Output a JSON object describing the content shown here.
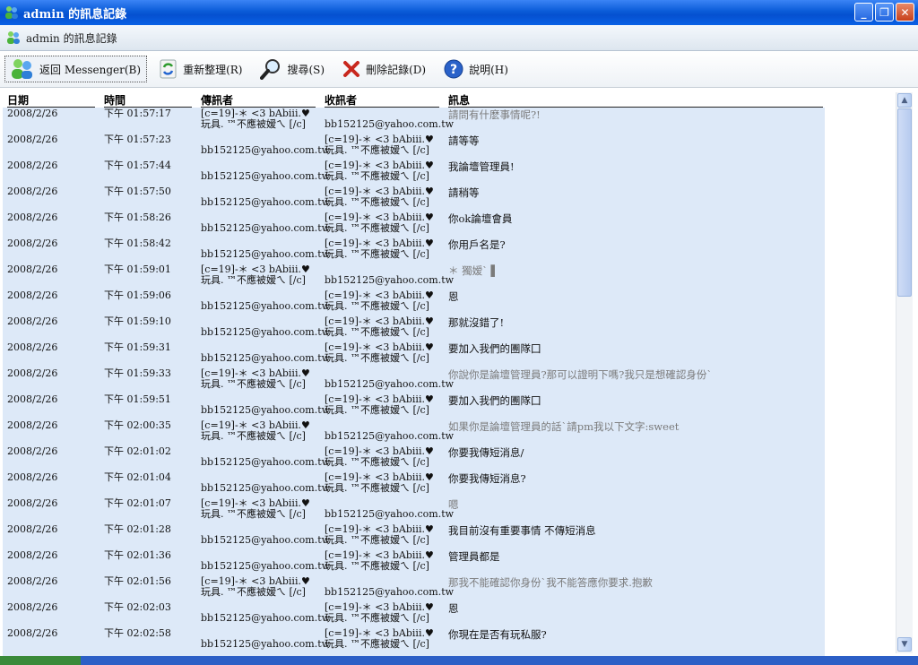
{
  "window": {
    "title": "admin 的訊息記錄"
  },
  "header": {
    "title": "admin 的訊息記錄"
  },
  "toolbar": {
    "back": "返回 Messenger(B)",
    "refresh": "重新整理(R)",
    "search": "搜尋(S)",
    "delete": "刪除記錄(D)",
    "help": "說明(H)"
  },
  "columns": {
    "date": "日期",
    "time": "時間",
    "from": "傳訊者",
    "to": "收訊者",
    "message": "訊息"
  },
  "rows": [
    {
      "date": "2008/2/26",
      "time": "下午 01:57:17",
      "from": "[c=19]-＊ <3 bAbiii.♥玩具. ™不應被嫒ㄟ [/c]",
      "to": "bb152125@yahoo.com.tw",
      "msg": "請問有什麽事情呢?!",
      "grey": true
    },
    {
      "date": "2008/2/26",
      "time": "下午 01:57:23",
      "from": "bb152125@yahoo.com.tw",
      "to": "[c=19]-＊ <3 bAbiii.♥玩具. ™不應被嫒ㄟ [/c]",
      "msg": "請等等",
      "grey": false
    },
    {
      "date": "2008/2/26",
      "time": "下午 01:57:44",
      "from": "bb152125@yahoo.com.tw",
      "to": "[c=19]-＊ <3 bAbiii.♥玩具. ™不應被嫒ㄟ [/c]",
      "msg": "我論壇管理員!",
      "grey": false
    },
    {
      "date": "2008/2/26",
      "time": "下午 01:57:50",
      "from": "bb152125@yahoo.com.tw",
      "to": "[c=19]-＊ <3 bAbiii.♥玩具. ™不應被嫒ㄟ [/c]",
      "msg": "請稍等",
      "grey": false
    },
    {
      "date": "2008/2/26",
      "time": "下午 01:58:26",
      "from": "bb152125@yahoo.com.tw",
      "to": "[c=19]-＊ <3 bAbiii.♥玩具. ™不應被嫒ㄟ [/c]",
      "msg": "你ok論壇會員",
      "grey": false
    },
    {
      "date": "2008/2/26",
      "time": "下午 01:58:42",
      "from": "bb152125@yahoo.com.tw",
      "to": "[c=19]-＊ <3 bAbiii.♥玩具. ™不應被嫒ㄟ [/c]",
      "msg": "你用戶名是?",
      "grey": false
    },
    {
      "date": "2008/2/26",
      "time": "下午 01:59:01",
      "from": "[c=19]-＊ <3 bAbiii.♥玩具. ™不應被嫒ㄟ [/c]",
      "to": "bb152125@yahoo.com.tw",
      "msg": "＊ 獨嫒` ▌",
      "grey": true
    },
    {
      "date": "2008/2/26",
      "time": "下午 01:59:06",
      "from": "bb152125@yahoo.com.tw",
      "to": "[c=19]-＊ <3 bAbiii.♥玩具. ™不應被嫒ㄟ [/c]",
      "msg": "恩",
      "grey": false
    },
    {
      "date": "2008/2/26",
      "time": "下午 01:59:10",
      "from": "bb152125@yahoo.com.tw",
      "to": "[c=19]-＊ <3 bAbiii.♥玩具. ™不應被嫒ㄟ [/c]",
      "msg": "那就沒錯了!",
      "grey": false
    },
    {
      "date": "2008/2/26",
      "time": "下午 01:59:31",
      "from": "bb152125@yahoo.com.tw",
      "to": "[c=19]-＊ <3 bAbiii.♥玩具. ™不應被嫒ㄟ [/c]",
      "msg": "要加入我們的團隊囗",
      "grey": false
    },
    {
      "date": "2008/2/26",
      "time": "下午 01:59:33",
      "from": "[c=19]-＊ <3 bAbiii.♥玩具. ™不應被嫒ㄟ [/c]",
      "to": "bb152125@yahoo.com.tw",
      "msg": "你說你是論壇管理員?那可以證明下嗎?我只是想確認身份`",
      "grey": true
    },
    {
      "date": "2008/2/26",
      "time": "下午 01:59:51",
      "from": "bb152125@yahoo.com.tw",
      "to": "[c=19]-＊ <3 bAbiii.♥玩具. ™不應被嫒ㄟ [/c]",
      "msg": "要加入我們的團隊囗",
      "grey": false
    },
    {
      "date": "2008/2/26",
      "time": "下午 02:00:35",
      "from": "[c=19]-＊ <3 bAbiii.♥玩具. ™不應被嫒ㄟ [/c]",
      "to": "bb152125@yahoo.com.tw",
      "msg": "如果你是論壇管理員的話`請pm我以下文字:sweet",
      "grey": true
    },
    {
      "date": "2008/2/26",
      "time": "下午 02:01:02",
      "from": "bb152125@yahoo.com.tw",
      "to": "[c=19]-＊ <3 bAbiii.♥玩具. ™不應被嫒ㄟ [/c]",
      "msg": "你要我傳短消息/",
      "grey": false
    },
    {
      "date": "2008/2/26",
      "time": "下午 02:01:04",
      "from": "bb152125@yahoo.com.tw",
      "to": "[c=19]-＊ <3 bAbiii.♥玩具. ™不應被嫒ㄟ [/c]",
      "msg": "你要我傳短消息?",
      "grey": false
    },
    {
      "date": "2008/2/26",
      "time": "下午 02:01:07",
      "from": "[c=19]-＊ <3 bAbiii.♥玩具. ™不應被嫒ㄟ [/c]",
      "to": "bb152125@yahoo.com.tw",
      "msg": "嗯",
      "grey": true
    },
    {
      "date": "2008/2/26",
      "time": "下午 02:01:28",
      "from": "bb152125@yahoo.com.tw",
      "to": "[c=19]-＊ <3 bAbiii.♥玩具. ™不應被嫒ㄟ [/c]",
      "msg": "我目前沒有重要事情 不傳短消息",
      "grey": false
    },
    {
      "date": "2008/2/26",
      "time": "下午 02:01:36",
      "from": "bb152125@yahoo.com.tw",
      "to": "[c=19]-＊ <3 bAbiii.♥玩具. ™不應被嫒ㄟ [/c]",
      "msg": "管理員都是",
      "grey": false
    },
    {
      "date": "2008/2/26",
      "time": "下午 02:01:56",
      "from": "[c=19]-＊ <3 bAbiii.♥玩具. ™不應被嫒ㄟ [/c]",
      "to": "bb152125@yahoo.com.tw",
      "msg": "那我不能確認你身份`我不能答應你要求.抱歉",
      "grey": true
    },
    {
      "date": "2008/2/26",
      "time": "下午 02:02:03",
      "from": "bb152125@yahoo.com.tw",
      "to": "[c=19]-＊ <3 bAbiii.♥玩具. ™不應被嫒ㄟ [/c]",
      "msg": "恩",
      "grey": false
    },
    {
      "date": "2008/2/26",
      "time": "下午 02:02:58",
      "from": "bb152125@yahoo.com.tw",
      "to": "[c=19]-＊ <3 bAbiii.♥玩具. ™不應被嫒ㄟ [/c]",
      "msg": "你現在是否有玩私服?",
      "grey": false
    }
  ],
  "colors": {
    "row_bg": "#dde9f8",
    "grey_text": "#7a7a7a",
    "titlebar": "#0a5bd8"
  }
}
